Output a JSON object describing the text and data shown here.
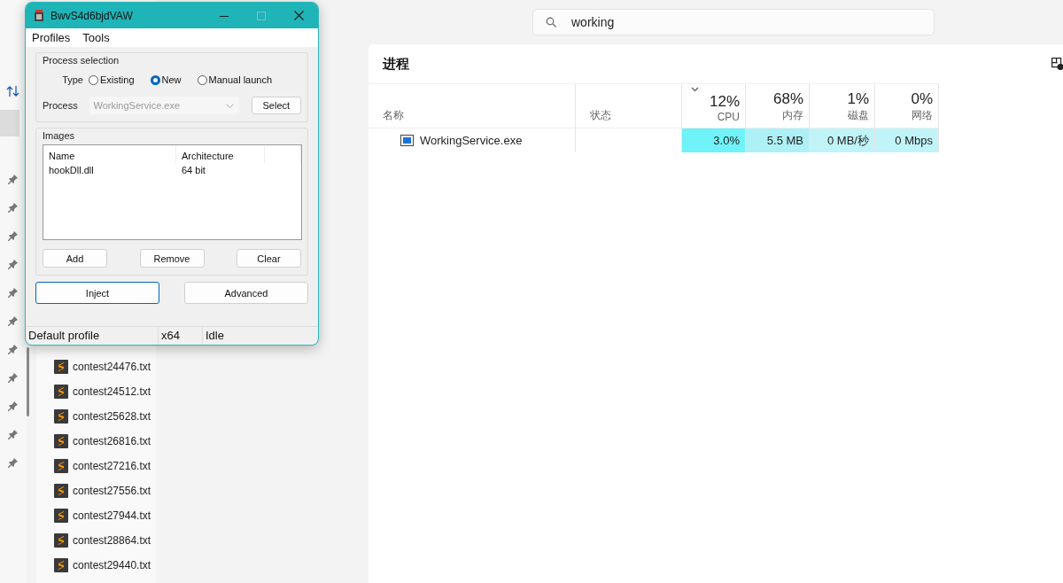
{
  "explorer": {
    "files": [
      "contest24476.txt",
      "contest24512.txt",
      "contest25628.txt",
      "contest26816.txt",
      "contest27216.txt",
      "contest27556.txt",
      "contest27944.txt",
      "contest28864.txt",
      "contest29440.txt"
    ]
  },
  "search": {
    "value": "working"
  },
  "task_manager": {
    "title": "进程",
    "columns": [
      {
        "heading": "名称"
      },
      {
        "heading": "状态"
      },
      {
        "heading": "CPU",
        "total": "12%",
        "sorted": true
      },
      {
        "heading": "内存",
        "total": "68%",
        "sorted": false
      },
      {
        "heading": "磁盘",
        "total": "1%",
        "sorted": false
      },
      {
        "heading": "网络",
        "total": "0%",
        "sorted": false
      }
    ],
    "rows": [
      {
        "cells": [
          {
            "value": "WorkingService.exe"
          },
          {},
          {
            "value": "3.0%",
            "color": "#6ff2f8"
          },
          {
            "value": "5.5 MB",
            "color": "#adf1f6"
          },
          {
            "value": "0 MB/秒",
            "color": "#c0f4f8"
          },
          {
            "value": "0 Mbps",
            "color": "#c0f4f8"
          }
        ]
      }
    ]
  },
  "injector": {
    "title": "BwvS4d6bjdVAW",
    "menu": [
      "Profiles",
      "Tools"
    ],
    "process_selection": {
      "label": "Process selection",
      "type_label": "Type",
      "types": [
        {
          "label": "Existing",
          "selected": false
        },
        {
          "label": "New",
          "selected": true
        },
        {
          "label": "Manual launch",
          "selected": false
        }
      ],
      "process_label": "Process",
      "process": {
        "value": "WorkingService.exe",
        "disabled": true
      },
      "select_button": "Select"
    },
    "images": {
      "label": "Images",
      "columns": [
        "Name",
        "Architecture"
      ],
      "rows": [
        [
          "hookDll.dll",
          "64 bit"
        ]
      ],
      "buttons": [
        "Add",
        "Remove",
        "Clear"
      ]
    },
    "buttons": [
      {
        "label": "Inject",
        "focused": true
      },
      {
        "label": "Advanced",
        "focused": false
      }
    ],
    "status_bar": [
      "Default profile",
      "x64",
      "Idle"
    ]
  }
}
